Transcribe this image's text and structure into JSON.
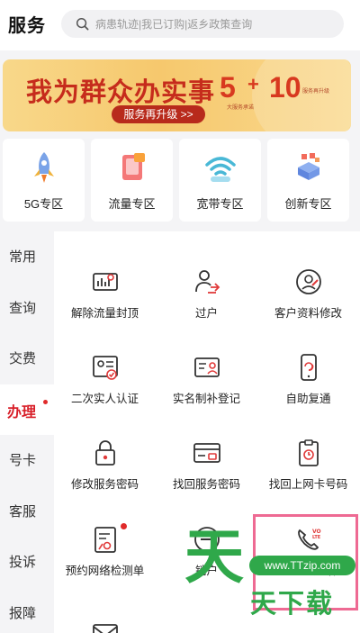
{
  "header": {
    "title": "服务",
    "search_placeholder": "病患轨迹|我已订购|返乡政策查询"
  },
  "banner": {
    "headline": "我为群众办实事",
    "button": "服务再升级 >>",
    "number_a": "5",
    "plus": "+",
    "number_b": "10",
    "caption_a": "大服务承诺",
    "caption_b": "服务再升级"
  },
  "zones": [
    {
      "label": "5G专区",
      "icon": "rocket-icon"
    },
    {
      "label": "流量专区",
      "icon": "data-package-icon"
    },
    {
      "label": "宽带专区",
      "icon": "wifi-icon"
    },
    {
      "label": "创新专区",
      "icon": "innovation-blocks-icon"
    }
  ],
  "nav": {
    "items": [
      {
        "label": "常用"
      },
      {
        "label": "查询"
      },
      {
        "label": "交费"
      },
      {
        "label": "办理",
        "active": true
      },
      {
        "label": "号卡"
      },
      {
        "label": "客服"
      },
      {
        "label": "投诉"
      },
      {
        "label": "报障"
      }
    ]
  },
  "services": [
    {
      "label": "解除流量封顶",
      "icon": "unlock-data-icon"
    },
    {
      "label": "过户",
      "icon": "transfer-user-icon"
    },
    {
      "label": "客户资料修改",
      "icon": "edit-profile-icon"
    },
    {
      "label": "二次实人认证",
      "icon": "identity-verify-icon"
    },
    {
      "label": "实名制补登记",
      "icon": "realname-register-icon"
    },
    {
      "label": "自助复通",
      "icon": "phone-restore-icon"
    },
    {
      "label": "修改服务密码",
      "icon": "lock-icon"
    },
    {
      "label": "找回服务密码",
      "icon": "password-card-icon"
    },
    {
      "label": "找回上网卡号码",
      "icon": "clipboard-clock-icon"
    },
    {
      "label": "预约网络检测单",
      "icon": "network-check-icon"
    },
    {
      "label": "销户",
      "icon": "cancel-account-icon"
    },
    {
      "label": "VoLTE通话",
      "icon": "volte-phone-icon"
    }
  ],
  "watermark": {
    "big_char": "天",
    "site": "www.TTzip.com",
    "brand": "天下载"
  },
  "colors": {
    "accent": "#d81e28",
    "banner_gold": "#f6c86d",
    "highlight": "#ee6a93",
    "watermark_green": "#2fa84a"
  }
}
